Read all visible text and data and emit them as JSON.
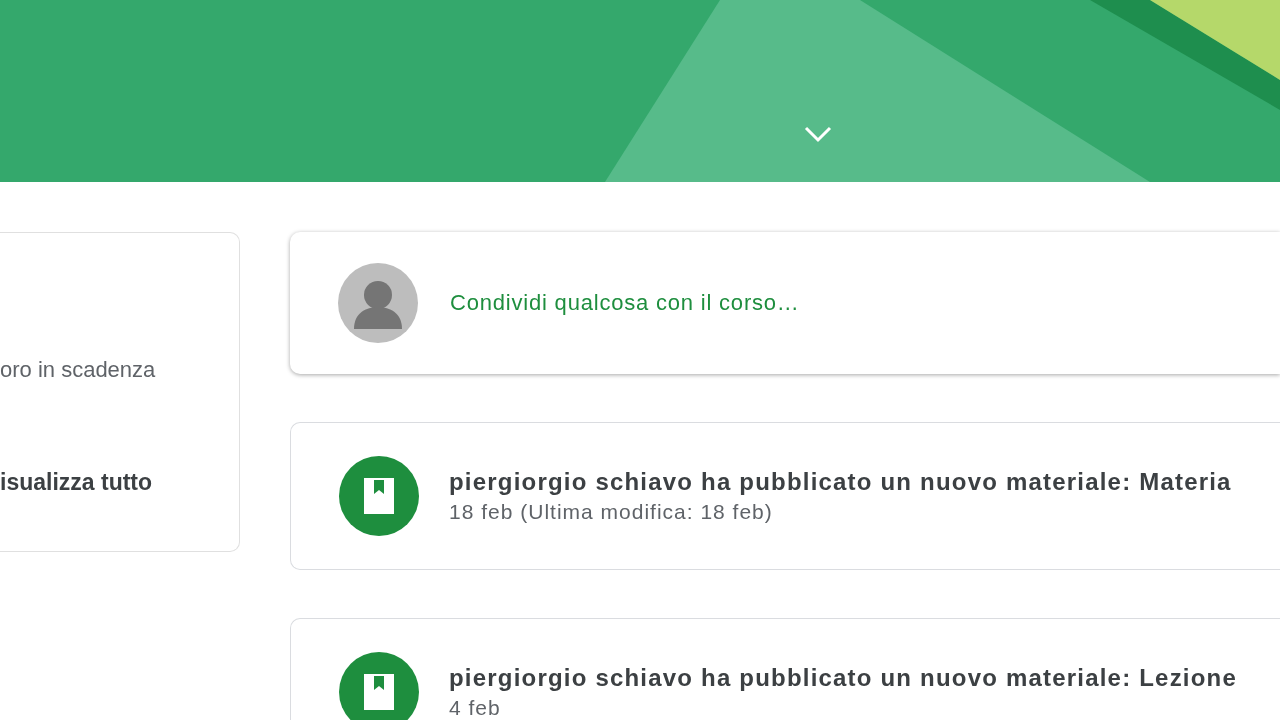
{
  "upcoming": {
    "text": "oro in scadenza",
    "link": "isualizza tutto"
  },
  "share_box": {
    "prompt": "Condividi qualcosa con il corso…"
  },
  "posts": [
    {
      "title": "piergiorgio schiavo ha pubblicato un nuovo materiale: Materia",
      "date": "18 feb (Ultima modifica: 18 feb)"
    },
    {
      "title": "piergiorgio schiavo ha pubblicato un nuovo materiale: Lezione",
      "date": "4 feb"
    }
  ]
}
